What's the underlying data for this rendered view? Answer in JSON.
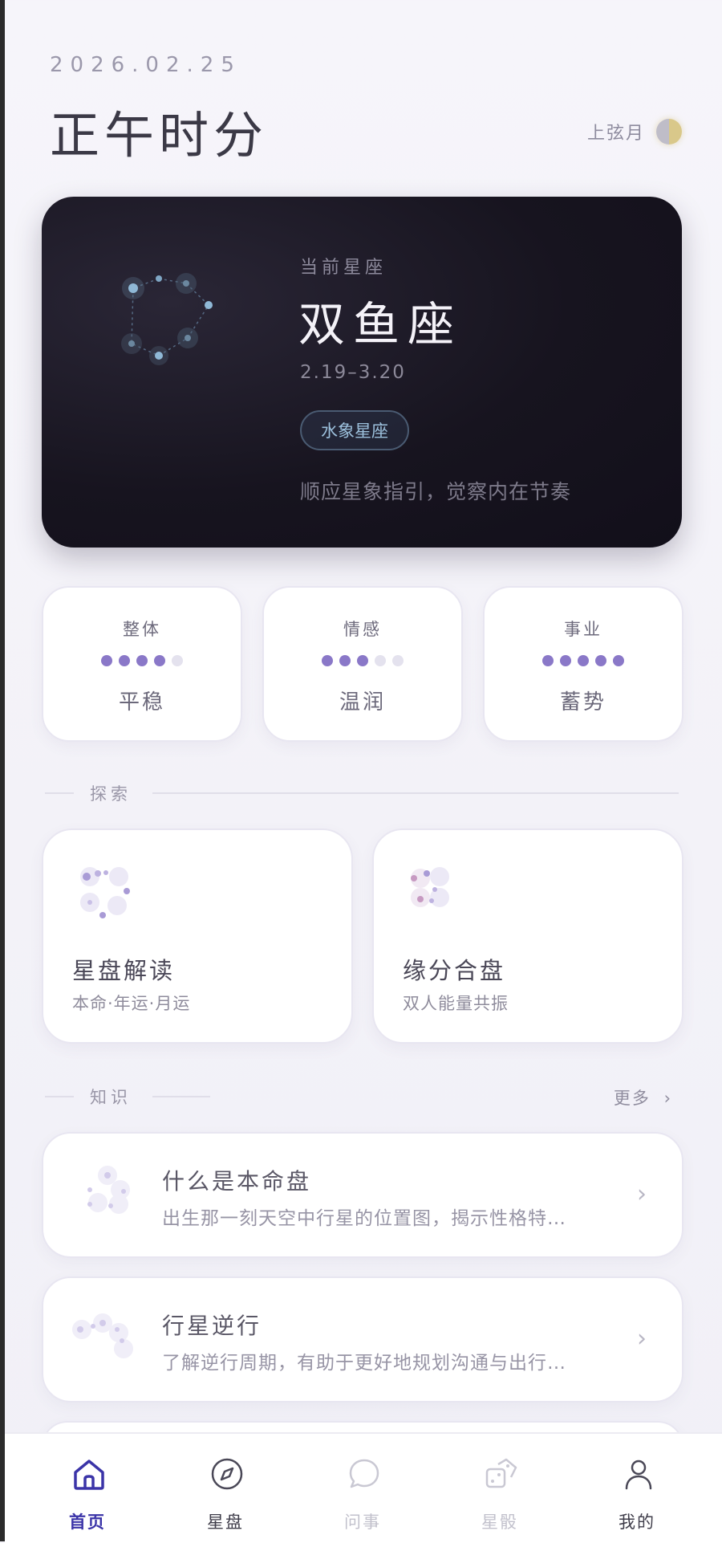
{
  "header": {
    "date": "2026.02.25",
    "title": "正午时分",
    "moon_phase": "上弦月"
  },
  "hero": {
    "subtitle": "当前星座",
    "sign": "双鱼座",
    "range": "2.19–3.20",
    "element_badge": "水象星座",
    "motto": "顺应星象指引，觉察内在节奏"
  },
  "stats": [
    {
      "label": "整体",
      "rating": 4,
      "max": 5,
      "value": "平稳"
    },
    {
      "label": "情感",
      "rating": 3,
      "max": 5,
      "value": "温润"
    },
    {
      "label": "事业",
      "rating": 5,
      "max": 5,
      "value": "蓄势"
    }
  ],
  "explore": {
    "section_title": "探索",
    "items": [
      {
        "title": "星盘解读",
        "subtitle": "本命·年运·月运"
      },
      {
        "title": "缘分合盘",
        "subtitle": "双人能量共振"
      }
    ]
  },
  "knowledge": {
    "section_title": "知识",
    "more_label": "更多",
    "items": [
      {
        "title": "什么是本命盘",
        "desc": "出生那一刻天空中行星的位置图，揭示性格特…"
      },
      {
        "title": "行星逆行",
        "desc": "了解逆行周期，有助于更好地规划沟通与出行…"
      }
    ]
  },
  "tabbar": [
    {
      "label": "首页",
      "icon": "home-icon",
      "state": "active"
    },
    {
      "label": "星盘",
      "icon": "compass-icon",
      "state": "normal"
    },
    {
      "label": "问事",
      "icon": "chat-bubble-icon",
      "state": "disabled"
    },
    {
      "label": "星骰",
      "icon": "dice-icon",
      "state": "disabled"
    },
    {
      "label": "我的",
      "icon": "user-icon",
      "state": "normal"
    }
  ],
  "colors": {
    "accent": "#3b34a8",
    "dot_on": "#8a78c8",
    "dot_off": "#e4e2ee",
    "hero_bg": "#17141f"
  }
}
